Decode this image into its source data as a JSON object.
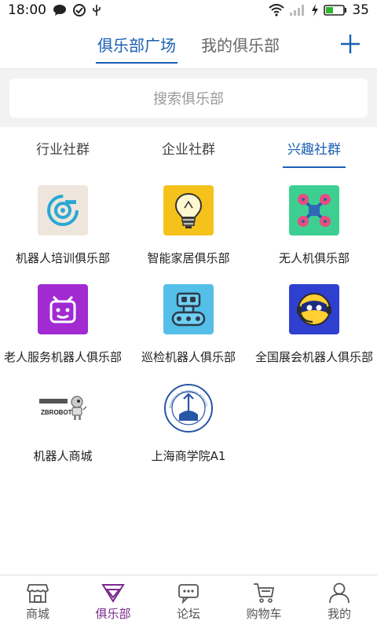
{
  "status": {
    "time": "18:00",
    "battery": "35"
  },
  "top_tabs": [
    {
      "label": "俱乐部广场",
      "active": true
    },
    {
      "label": "我的俱乐部",
      "active": false
    }
  ],
  "search": {
    "placeholder": "搜索俱乐部"
  },
  "categories": [
    {
      "label": "行业社群",
      "active": false
    },
    {
      "label": "企业社群",
      "active": false
    },
    {
      "label": "兴趣社群",
      "active": true
    }
  ],
  "clubs": [
    {
      "label": "机器人培训俱乐部",
      "icon": "robot-eye-icon"
    },
    {
      "label": "智能家居俱乐部",
      "icon": "lightbulb-icon"
    },
    {
      "label": "无人机俱乐部",
      "icon": "drone-icon"
    },
    {
      "label": "老人服务机器人俱乐部",
      "icon": "robot-face-icon"
    },
    {
      "label": "巡检机器人俱乐部",
      "icon": "tracked-robot-icon"
    },
    {
      "label": "全国展会机器人俱乐部",
      "icon": "robot-headset-icon"
    },
    {
      "label": "机器人商城",
      "icon": "zbrobot-logo",
      "logo_text": "ZBROBOT"
    },
    {
      "label": "上海商学院A1",
      "icon": "school-seal-logo",
      "logo_text": "SHANGHAI BUSINESS SCHOOL"
    }
  ],
  "bottom_nav": [
    {
      "label": "商城",
      "icon": "shop-icon",
      "active": false
    },
    {
      "label": "俱乐部",
      "icon": "diamond-icon",
      "active": true
    },
    {
      "label": "论坛",
      "icon": "chat-icon",
      "active": false
    },
    {
      "label": "购物车",
      "icon": "cart-icon",
      "active": false
    },
    {
      "label": "我的",
      "icon": "person-icon",
      "active": false
    }
  ]
}
